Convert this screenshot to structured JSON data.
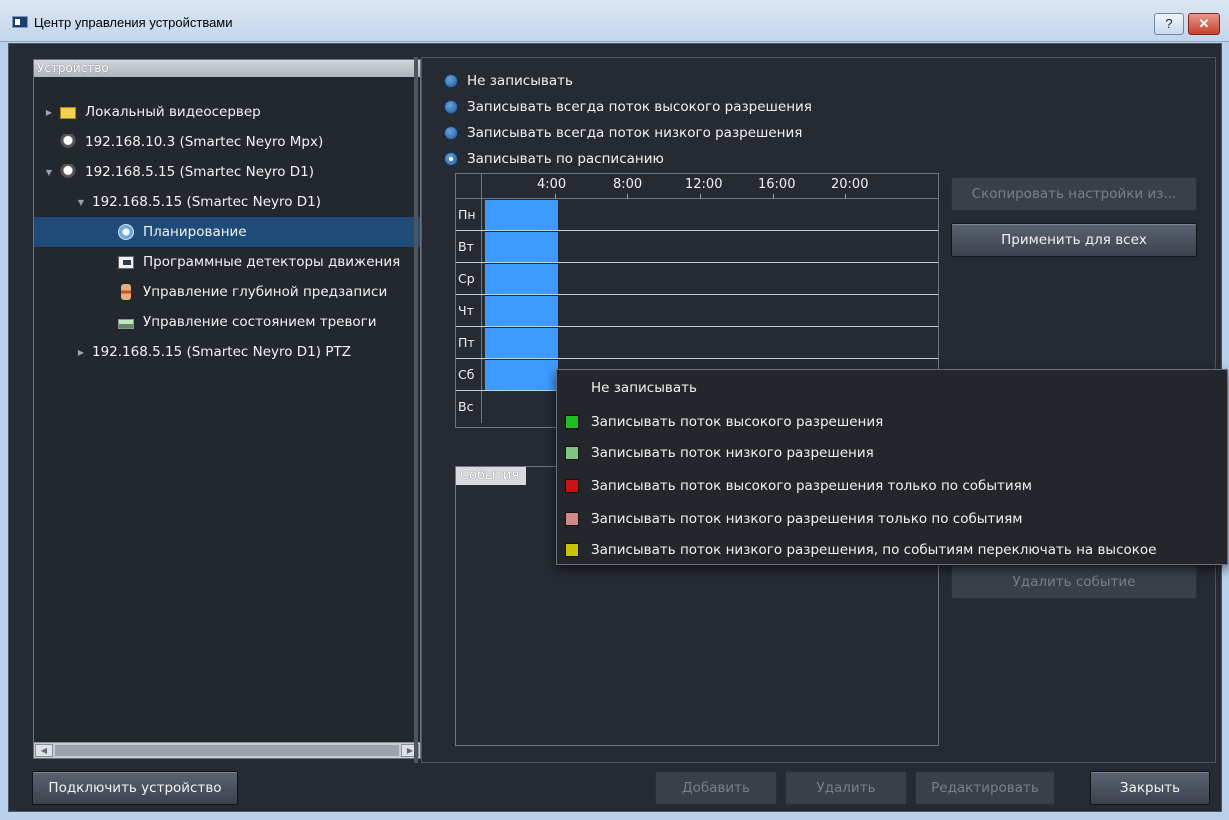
{
  "window": {
    "title": "Центр управления устройствами",
    "help_label": "?",
    "close_label": "✕"
  },
  "tree": {
    "header": "Устройство",
    "items": [
      {
        "label": "Локальный видеосервер",
        "icon": "folder-icon"
      },
      {
        "label": "192.168.10.3 (Smartec Neyro Mpx)",
        "icon": "camera-icon"
      },
      {
        "label": "192.168.5.15 (Smartec Neyro D1)",
        "icon": "camera-icon"
      },
      {
        "label": "192.168.5.15 (Smartec Neyro D1)",
        "icon": ""
      },
      {
        "label": "Планирование",
        "icon": "clock-icon"
      },
      {
        "label": "Программные детекторы движения",
        "icon": "motion-detector-icon"
      },
      {
        "label": "Управление глубиной предзаписи",
        "icon": "pre-record-depth-icon"
      },
      {
        "label": "Управление состоянием тревоги",
        "icon": "alarm-state-icon"
      },
      {
        "label": "192.168.5.15 (Smartec Neyro D1) PTZ",
        "icon": ""
      }
    ]
  },
  "record_options": [
    {
      "label": "Не записывать",
      "checked": false
    },
    {
      "label": "Записывать всегда поток высокого разрешения",
      "checked": false
    },
    {
      "label": "Записывать всегда поток низкого разрешения",
      "checked": false
    },
    {
      "label": "Записывать по расписанию",
      "checked": true
    }
  ],
  "schedule": {
    "hours": [
      "4:00",
      "8:00",
      "12:00",
      "16:00",
      "20:00"
    ],
    "days": [
      "Пн",
      "Вт",
      "Ср",
      "Чт",
      "Пт",
      "Сб",
      "Вс"
    ],
    "recorded_hours": [
      [
        0,
        4
      ],
      [
        0,
        4
      ],
      [
        0,
        4
      ],
      [
        0,
        4
      ],
      [
        0,
        4
      ],
      [
        0,
        4
      ],
      null
    ],
    "block_color": "#3b9bff"
  },
  "buttons": {
    "copy_settings": "Скопировать настройки из...",
    "apply_all": "Применить для всех",
    "delete_event": "Удалить событие",
    "connect_device": "Подключить устройство",
    "add": "Добавить",
    "delete": "Удалить",
    "edit": "Редактировать",
    "close": "Закрыть"
  },
  "events": {
    "title": "События"
  },
  "context_menu": {
    "items": [
      {
        "label": "Не записывать",
        "color": null
      },
      {
        "label": "Записывать поток высокого разрешения",
        "color": "#1fbf1f"
      },
      {
        "label": "Записывать поток низкого разрешения",
        "color": "#7fc47f"
      },
      {
        "label": "Записывать поток высокого разрешения только по событиям",
        "color": "#c81414"
      },
      {
        "label": "Записывать поток низкого разрешения только по событиям",
        "color": "#d28a88"
      },
      {
        "label": "Записывать поток низкого разрешения, по событиям переключать на высокое",
        "color": "#c8c400"
      }
    ]
  }
}
